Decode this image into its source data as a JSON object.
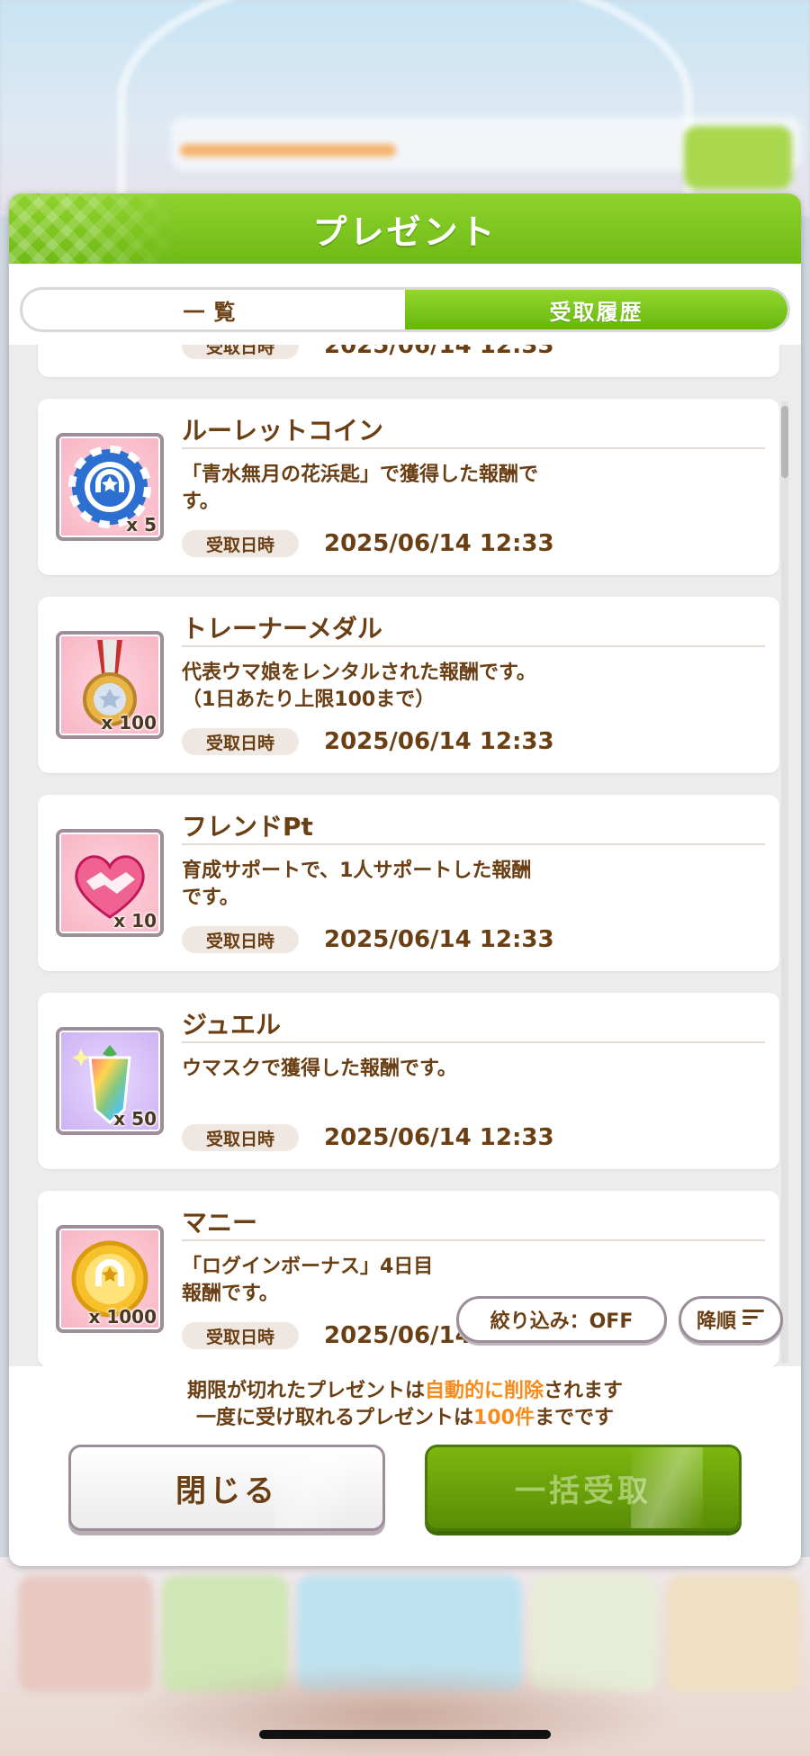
{
  "dialog": {
    "title": "プレゼント",
    "tabs": [
      {
        "label": "一覧",
        "active": false
      },
      {
        "label": "受取履歴",
        "active": true
      }
    ]
  },
  "history": {
    "received_label": "受取日時",
    "items": [
      {
        "name": "",
        "description": "す。",
        "quantity": "x 5",
        "icon": "roulette-coin-icon",
        "received_at": "2025/06/14 12:33"
      },
      {
        "name": "ルーレットコイン",
        "description": "「青水無月の花浜匙」で獲得した報酬で\nす。",
        "quantity": "x 5",
        "icon": "roulette-coin-icon",
        "received_at": "2025/06/14 12:33"
      },
      {
        "name": "トレーナーメダル",
        "description": "代表ウマ娘をレンタルされた報酬です。\n（1日あたり上限100まで）",
        "quantity": "x 100",
        "icon": "trainer-medal-icon",
        "received_at": "2025/06/14 12:33"
      },
      {
        "name": "フレンドPt",
        "description": "育成サポートで、1人サポートした報酬\nです。",
        "quantity": "x 10",
        "icon": "handshake-icon",
        "received_at": "2025/06/14 12:33"
      },
      {
        "name": "ジュエル",
        "description": "ウマスクで獲得した報酬です。",
        "quantity": "x 50",
        "icon": "jewel-icon",
        "received_at": "2025/06/14 12:33"
      },
      {
        "name": "マニー",
        "description": "「ログインボーナス」4日目\n報酬です。",
        "quantity": "x 1000",
        "icon": "money-coin-icon",
        "received_at": "2025/06/14 12:33"
      }
    ]
  },
  "controls": {
    "filter_label": "絞り込み：OFF",
    "order_label": "降順",
    "order_icon": "sort-lines-icon"
  },
  "notice": {
    "line1_prefix": "期限が切れたプレゼントは",
    "line1_highlight": "自動的に削除",
    "line1_suffix": "されます",
    "line2_prefix": "一度に受け取れるプレゼントは",
    "line2_highlight": "100件",
    "line2_suffix": "までです",
    "highlight_color": "#f58b1a"
  },
  "buttons": {
    "close_label": "閉じる",
    "receive_all_label": "一括受取"
  },
  "colors": {
    "header_green": "#7cc61f",
    "text_brown": "#6b3f14"
  }
}
